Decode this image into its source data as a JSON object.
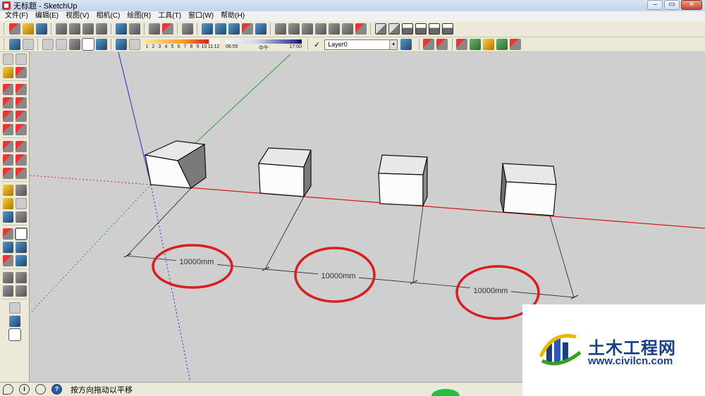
{
  "window": {
    "title": "无标题 - SketchUp",
    "controls": {
      "minimize": "–",
      "maximize": "▭",
      "close": "✕"
    }
  },
  "menu": {
    "items": [
      {
        "label": "文件(F)"
      },
      {
        "label": "编辑(E)"
      },
      {
        "label": "视图(V)"
      },
      {
        "label": "相机(C)"
      },
      {
        "label": "绘图(R)"
      },
      {
        "label": "工具(T)"
      },
      {
        "label": "窗口(W)"
      },
      {
        "label": "帮助(H)"
      }
    ]
  },
  "shadow_settings": {
    "month_ticks": [
      "1",
      "2",
      "3",
      "4",
      "5",
      "6",
      "7",
      "8",
      "9",
      "10",
      "11",
      "12"
    ],
    "time_start": "06:55",
    "time_mid": "中午",
    "time_end": "17:00"
  },
  "layers": {
    "check": "✓",
    "current": "Layer0",
    "arrow": "▾"
  },
  "scene": {
    "dimensions": [
      {
        "label": "10000mm"
      },
      {
        "label": "10000mm"
      },
      {
        "label": "10000mm"
      }
    ],
    "colors": {
      "red_axis": "#d42020",
      "green_axis": "#2aa02a",
      "blue_axis": "#2030c8",
      "highlight": "#d81e1e"
    }
  },
  "status": {
    "icons": [
      "?",
      "i",
      "person",
      "?"
    ],
    "info_glyph": "i",
    "help_glyph": "?",
    "text": "按方向拖动以平移"
  },
  "watermark": {
    "title": "土木工程网",
    "url": "www.civilcn.com"
  }
}
